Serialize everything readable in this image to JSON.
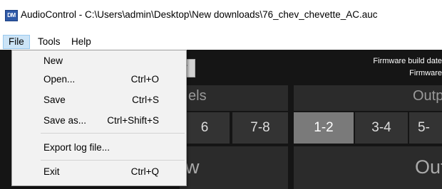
{
  "window": {
    "app_icon_text": "DM",
    "title": "AudioControl - C:\\Users\\admin\\Desktop\\New downloads\\76_chev_chevette_AC.auc"
  },
  "menubar": {
    "items": [
      {
        "label": "File"
      },
      {
        "label": "Tools"
      },
      {
        "label": "Help"
      }
    ]
  },
  "file_menu": {
    "items": [
      {
        "label": "New",
        "shortcut": ""
      },
      {
        "label": "Open...",
        "shortcut": "Ctrl+O"
      },
      {
        "label": "Save",
        "shortcut": "Ctrl+S"
      },
      {
        "label": "Save as...",
        "shortcut": "Ctrl+Shift+S"
      },
      {
        "label": "Export log file...",
        "shortcut": ""
      },
      {
        "label": "Exit",
        "shortcut": "Ctrl+Q"
      }
    ]
  },
  "firmware": {
    "line1": "Firmware build date",
    "line2": "Firmware"
  },
  "inputs": {
    "header": "els",
    "body": "w",
    "tabs": [
      "6",
      "7-8"
    ]
  },
  "outputs": {
    "header": "Outp",
    "body": "Out",
    "tabs": [
      "1-2",
      "3-4",
      "5-"
    ],
    "active_tab": "1-2"
  },
  "colors": {
    "menu_highlight": "#cce4f7",
    "app_background": "#151515",
    "panel": "#2b2b2b",
    "active_tab": "#7a7a7a"
  }
}
